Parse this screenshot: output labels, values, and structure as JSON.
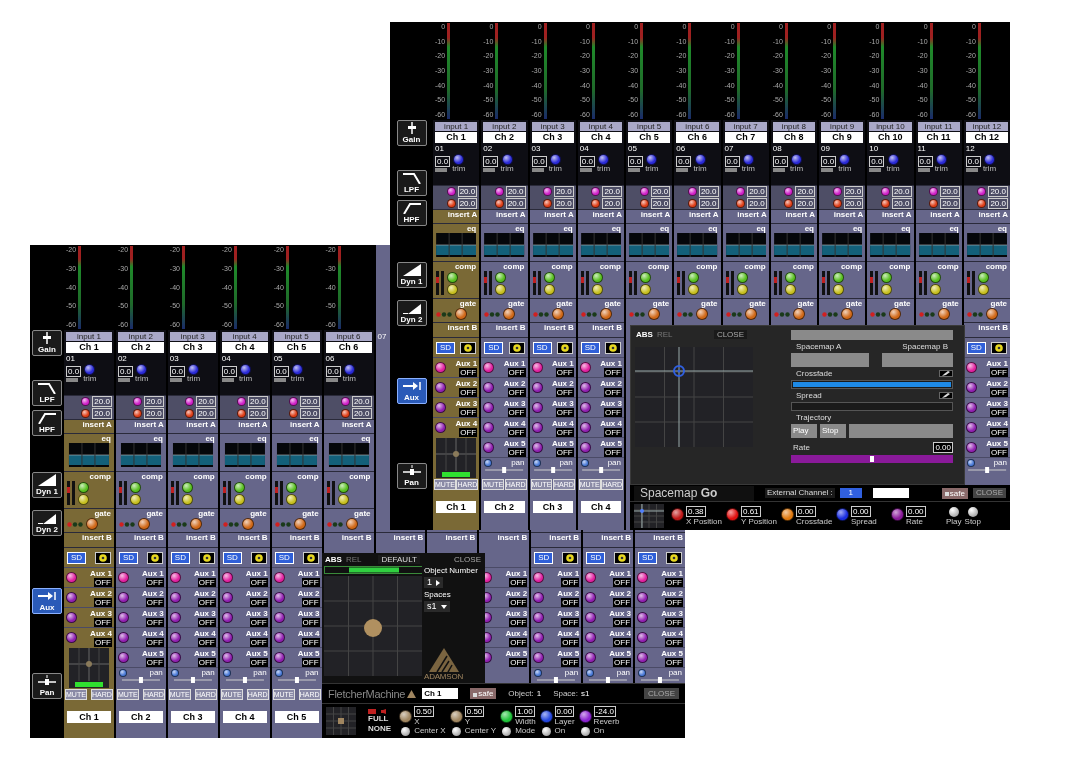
{
  "windows": [
    {
      "sidebar": [
        {
          "kind": "gain",
          "label": "Gain",
          "selected": false
        },
        {
          "kind": "lpf",
          "label": "LPF",
          "selected": false
        },
        {
          "kind": "hpf",
          "label": "HPF",
          "selected": false
        },
        {
          "kind": "dyn1",
          "label": "Dyn 1",
          "selected": false
        },
        {
          "kind": "dyn2",
          "label": "Dyn 2",
          "selected": false
        },
        {
          "kind": "aux",
          "label": "Aux",
          "selected": true
        },
        {
          "kind": "pan",
          "label": "Pan",
          "selected": false
        }
      ],
      "strips": [
        {
          "selected": true,
          "meter_scale": [
            "-20",
            "-30",
            "-40",
            "-50",
            "-60"
          ],
          "input": "input 1",
          "name": "Ch 1",
          "num": "01",
          "gain": "0.0",
          "trim": "trim",
          "lpf": "20.0",
          "hpf": "20.0",
          "insert_a": "insert A",
          "eq": "eq",
          "comp": "comp",
          "gate": "gate",
          "insert_b": "insert B",
          "sd": "SD",
          "sends": [
            {
              "label": "Aux 1",
              "state": "OFF"
            },
            {
              "label": "Aux 2",
              "state": "OFF"
            },
            {
              "label": "Aux 3",
              "state": "OFF"
            },
            {
              "label": "Aux 4",
              "state": "OFF"
            }
          ],
          "pad": true,
          "mute": "MUTE",
          "hard": "HARD",
          "name_bottom": "Ch 1"
        },
        {
          "selected": false,
          "meter_scale": [
            "-20",
            "-30",
            "-40",
            "-50",
            "-60"
          ],
          "input": "input 2",
          "name": "Ch 2",
          "num": "02",
          "gain": "0.0",
          "trim": "trim",
          "lpf": "20.0",
          "hpf": "20.0",
          "insert_a": "insert A",
          "eq": "eq",
          "comp": "comp",
          "gate": "gate",
          "insert_b": "insert B",
          "sd": "SD",
          "sends": [
            {
              "label": "Aux 1",
              "state": "OFF"
            },
            {
              "label": "Aux 2",
              "state": "OFF"
            },
            {
              "label": "Aux 3",
              "state": "OFF"
            },
            {
              "label": "Aux 4",
              "state": "OFF"
            },
            {
              "label": "Aux 5",
              "state": "OFF"
            }
          ],
          "pan": "pan",
          "mute": "MUTE",
          "hard": "HARD",
          "name_bottom": "Ch 2"
        },
        {
          "selected": false,
          "meter_scale": [
            "-20",
            "-30",
            "-40",
            "-50",
            "-60"
          ],
          "input": "input 3",
          "name": "Ch 3",
          "num": "03",
          "gain": "0.0",
          "trim": "trim",
          "lpf": "20.0",
          "hpf": "20.0",
          "insert_a": "insert A",
          "eq": "eq",
          "comp": "comp",
          "gate": "gate",
          "insert_b": "insert B",
          "sd": "SD",
          "sends": [
            {
              "label": "Aux 1",
              "state": "OFF"
            },
            {
              "label": "Aux 2",
              "state": "OFF"
            },
            {
              "label": "Aux 3",
              "state": "OFF"
            },
            {
              "label": "Aux 4",
              "state": "OFF"
            },
            {
              "label": "Aux 5",
              "state": "OFF"
            }
          ],
          "pan": "pan",
          "mute": "MUTE",
          "hard": "HARD",
          "name_bottom": "Ch 3"
        },
        {
          "selected": false,
          "meter_scale": [
            "-20",
            "-30",
            "-40",
            "-50",
            "-60"
          ],
          "input": "input 4",
          "name": "Ch 4",
          "num": "04",
          "gain": "0.0",
          "trim": "trim",
          "lpf": "20.0",
          "hpf": "20.0",
          "insert_a": "insert A",
          "eq": "eq",
          "comp": "comp",
          "gate": "gate",
          "insert_b": "insert B",
          "sd": "SD",
          "sends": [
            {
              "label": "Aux 1",
              "state": "OFF"
            },
            {
              "label": "Aux 2",
              "state": "OFF"
            },
            {
              "label": "Aux 3",
              "state": "OFF"
            },
            {
              "label": "Aux 4",
              "state": "OFF"
            },
            {
              "label": "Aux 5",
              "state": "OFF"
            }
          ],
          "pan": "pan",
          "mute": "MUTE",
          "hard": "HARD",
          "name_bottom": "Ch 4"
        },
        {
          "selected": false,
          "meter_scale": [
            "-20",
            "-30",
            "-40",
            "-50",
            "-60"
          ],
          "input": "input 5",
          "name": "Ch 5",
          "num": "05",
          "gain": "0.0",
          "trim": "trim",
          "lpf": "20.0",
          "hpf": "20.0",
          "insert_a": "insert A",
          "eq": "eq",
          "comp": "comp",
          "gate": "gate",
          "insert_b": "insert B",
          "sd": "SD",
          "sends": [
            {
              "label": "Aux 1",
              "state": "OFF"
            },
            {
              "label": "Aux 2",
              "state": "OFF"
            },
            {
              "label": "Aux 3",
              "state": "OFF"
            },
            {
              "label": "Aux 4",
              "state": "OFF"
            },
            {
              "label": "Aux 5",
              "state": "OFF"
            }
          ],
          "pan": "pan",
          "mute": "MUTE",
          "hard": "HARD",
          "name_bottom": "Ch 5"
        },
        {
          "selected": false,
          "meter_scale": [
            "-20",
            "-30",
            "-40",
            "-50",
            "-60"
          ],
          "input": "input 6",
          "name": "Ch 6",
          "num": "06",
          "gain": "0.0",
          "trim": "trim",
          "lpf": "20.0",
          "hpf": "20.0",
          "insert_a": "insert A",
          "eq": "eq",
          "comp": "comp",
          "gate": "gate",
          "insert_b": "insert B"
        },
        {
          "selected": false,
          "num": "07",
          "insert_b": "insert B"
        },
        {
          "selected": false,
          "insert_b": "insert B"
        },
        {
          "selected": false,
          "insert_b": "insert B",
          "sends": [
            {
              "label": "Aux 1",
              "state": "OFF"
            },
            {
              "label": "Aux 2",
              "state": "OFF"
            },
            {
              "label": "Aux 3",
              "state": "OFF"
            },
            {
              "label": "Aux 4",
              "state": "OFF"
            },
            {
              "label": "Aux 5",
              "state": "OFF"
            }
          ]
        },
        {
          "selected": false,
          "insert_b": "insert B",
          "sd": "SD",
          "sends": [
            {
              "label": "Aux 1",
              "state": "OFF"
            },
            {
              "label": "Aux 2",
              "state": "OFF"
            },
            {
              "label": "Aux 3",
              "state": "OFF"
            },
            {
              "label": "Aux 4",
              "state": "OFF"
            },
            {
              "label": "Aux 5",
              "state": "OFF"
            }
          ],
          "pan": "pan"
        },
        {
          "selected": false,
          "insert_b": "insert B",
          "sd": "SD",
          "sends": [
            {
              "label": "Aux 1",
              "state": "OFF"
            },
            {
              "label": "Aux 2",
              "state": "OFF"
            },
            {
              "label": "Aux 3",
              "state": "OFF"
            },
            {
              "label": "Aux 4",
              "state": "OFF"
            },
            {
              "label": "Aux 5",
              "state": "OFF"
            }
          ],
          "pan": "pan"
        },
        {
          "selected": false,
          "insert_b": "insert B",
          "sd": "SD",
          "sends": [
            {
              "label": "Aux 1",
              "state": "OFF"
            },
            {
              "label": "Aux 2",
              "state": "OFF"
            },
            {
              "label": "Aux 3",
              "state": "OFF"
            },
            {
              "label": "Aux 4",
              "state": "OFF"
            },
            {
              "label": "Aux 5",
              "state": "OFF"
            }
          ],
          "pan": "pan"
        }
      ],
      "panel": {
        "kind": "fletcher",
        "tabs": [
          {
            "label": "ABS",
            "selected": true
          },
          {
            "label": "REL",
            "selected": false
          }
        ],
        "default_button": "DEFAULT",
        "close_button": "CLOSE",
        "object_number_label": "Object Number",
        "object_number": "1",
        "spaces_label": "Spaces",
        "space": "s1",
        "logo": "ADAMSON",
        "brand": "FletcherMachine",
        "channel": "Ch 1",
        "safe": "safe",
        "object_label": "Object:",
        "object_value": "1",
        "space_label": "Space:",
        "space_value": "s1",
        "close_bottom": "CLOSE",
        "modes": [
          "FULL",
          "NONE"
        ],
        "controls": [
          {
            "label": "X",
            "value": "0.50",
            "color": "#a08660",
            "button": "Center X"
          },
          {
            "label": "Y",
            "value": "0.50",
            "color": "#a08660",
            "button": "Center Y"
          },
          {
            "label": "Width",
            "value": "1.00",
            "color": "#1fc43a",
            "button": "Mode"
          },
          {
            "label": "Layer",
            "value": "0.00",
            "color": "#2346e0",
            "button": "On"
          },
          {
            "label": "Reverb",
            "value": "-24.0",
            "color": "#8a22d0",
            "button": "On"
          }
        ]
      }
    },
    {
      "sidebar": [
        {
          "kind": "gain",
          "label": "Gain",
          "selected": false
        },
        {
          "kind": "lpf",
          "label": "LPF",
          "selected": false
        },
        {
          "kind": "hpf",
          "label": "HPF",
          "selected": false
        },
        {
          "kind": "dyn1",
          "label": "Dyn 1",
          "selected": false
        },
        {
          "kind": "dyn2",
          "label": "Dyn 2",
          "selected": false
        },
        {
          "kind": "aux",
          "label": "Aux",
          "selected": true
        },
        {
          "kind": "pan",
          "label": "Pan",
          "selected": false
        }
      ],
      "strips": [
        {
          "selected": true,
          "meter_scale": [
            "0",
            "-10",
            "-20",
            "-30",
            "-40",
            "-50",
            "-60"
          ],
          "input": "input 1",
          "name": "Ch 1",
          "num": "01",
          "gain": "0.0",
          "trim": "trim",
          "lpf": "20.0",
          "hpf": "20.0",
          "insert_a": "insert A",
          "eq": "eq",
          "comp": "comp",
          "gate": "gate",
          "insert_b": "insert B",
          "sd": "SD",
          "sends": [
            {
              "label": "Aux 1",
              "state": "OFF"
            },
            {
              "label": "Aux 2",
              "state": "OFF"
            },
            {
              "label": "Aux 3",
              "state": "OFF"
            },
            {
              "label": "Aux 4",
              "state": "OFF"
            }
          ],
          "pad": true,
          "mute": "MUTE",
          "hard": "HARD",
          "name_bottom": "Ch 1"
        },
        {
          "selected": false,
          "meter_scale": [
            "0",
            "-10",
            "-20",
            "-30",
            "-40",
            "-50",
            "-60"
          ],
          "input": "input 2",
          "name": "Ch 2",
          "num": "02",
          "gain": "0.0",
          "trim": "trim",
          "lpf": "20.0",
          "hpf": "20.0",
          "insert_a": "insert A",
          "eq": "eq",
          "comp": "comp",
          "gate": "gate",
          "insert_b": "insert B",
          "sd": "SD",
          "sends": [
            {
              "label": "Aux 1",
              "state": "OFF"
            },
            {
              "label": "Aux 2",
              "state": "OFF"
            },
            {
              "label": "Aux 3",
              "state": "OFF"
            },
            {
              "label": "Aux 4",
              "state": "OFF"
            },
            {
              "label": "Aux 5",
              "state": "OFF"
            }
          ],
          "pan": "pan",
          "mute": "MUTE",
          "hard": "HARD",
          "name_bottom": "Ch 2"
        },
        {
          "selected": false,
          "meter_scale": [
            "0",
            "-10",
            "-20",
            "-30",
            "-40",
            "-50",
            "-60"
          ],
          "input": "input 3",
          "name": "Ch 3",
          "num": "03",
          "gain": "0.0",
          "trim": "trim",
          "lpf": "20.0",
          "hpf": "20.0",
          "insert_a": "insert A",
          "eq": "eq",
          "comp": "comp",
          "gate": "gate",
          "insert_b": "insert B",
          "sd": "SD",
          "sends": [
            {
              "label": "Aux 1",
              "state": "OFF"
            },
            {
              "label": "Aux 2",
              "state": "OFF"
            },
            {
              "label": "Aux 3",
              "state": "OFF"
            },
            {
              "label": "Aux 4",
              "state": "OFF"
            },
            {
              "label": "Aux 5",
              "state": "OFF"
            }
          ],
          "pan": "pan",
          "mute": "MUTE",
          "hard": "HARD",
          "name_bottom": "Ch 3"
        },
        {
          "selected": false,
          "meter_scale": [
            "0",
            "-10",
            "-20",
            "-30",
            "-40",
            "-50",
            "-60"
          ],
          "input": "input 4",
          "name": "Ch 4",
          "num": "04",
          "gain": "0.0",
          "trim": "trim",
          "lpf": "20.0",
          "hpf": "20.0",
          "insert_a": "insert A",
          "eq": "eq",
          "comp": "comp",
          "gate": "gate",
          "insert_b": "insert B",
          "sd": "SD",
          "sends": [
            {
              "label": "Aux 1",
              "state": "OFF"
            },
            {
              "label": "Aux 2",
              "state": "OFF"
            },
            {
              "label": "Aux 3",
              "state": "OFF"
            },
            {
              "label": "Aux 4",
              "state": "OFF"
            },
            {
              "label": "Aux 5",
              "state": "OFF"
            }
          ],
          "pan": "pan",
          "mute": "MUTE",
          "hard": "HARD",
          "name_bottom": "Ch 4"
        },
        {
          "selected": false,
          "meter_scale": [
            "0",
            "-10",
            "-20",
            "-30",
            "-40",
            "-50",
            "-60"
          ],
          "input": "input 5",
          "name": "Ch 5",
          "num": "05",
          "gain": "0.0",
          "trim": "trim",
          "lpf": "20.0",
          "hpf": "20.0",
          "insert_a": "insert A",
          "eq": "eq",
          "comp": "comp",
          "gate": "gate"
        },
        {
          "selected": false,
          "meter_scale": [
            "0",
            "-10",
            "-20",
            "-30",
            "-40",
            "-50",
            "-60"
          ],
          "input": "input 6",
          "name": "Ch 6",
          "num": "06",
          "gain": "0.0",
          "trim": "trim",
          "lpf": "20.0",
          "hpf": "20.0",
          "insert_a": "insert A",
          "eq": "eq",
          "comp": "comp",
          "gate": "gate"
        },
        {
          "selected": false,
          "meter_scale": [
            "0",
            "-10",
            "-20",
            "-30",
            "-40",
            "-50",
            "-60"
          ],
          "input": "input 7",
          "name": "Ch 7",
          "num": "07",
          "gain": "0.0",
          "trim": "trim",
          "lpf": "20.0",
          "hpf": "20.0",
          "insert_a": "insert A",
          "eq": "eq",
          "comp": "comp",
          "gate": "gate"
        },
        {
          "selected": false,
          "meter_scale": [
            "0",
            "-10",
            "-20",
            "-30",
            "-40",
            "-50",
            "-60"
          ],
          "input": "input 8",
          "name": "Ch 8",
          "num": "08",
          "gain": "0.0",
          "trim": "trim",
          "lpf": "20.0",
          "hpf": "20.0",
          "insert_a": "insert A",
          "eq": "eq",
          "comp": "comp",
          "gate": "gate"
        },
        {
          "selected": false,
          "meter_scale": [
            "0",
            "-10",
            "-20",
            "-30",
            "-40",
            "-50",
            "-60"
          ],
          "input": "input 9",
          "name": "Ch 9",
          "num": "09",
          "gain": "0.0",
          "trim": "trim",
          "lpf": "20.0",
          "hpf": "20.0",
          "insert_a": "insert A",
          "eq": "eq",
          "comp": "comp",
          "gate": "gate"
        },
        {
          "selected": false,
          "meter_scale": [
            "0",
            "-10",
            "-20",
            "-30",
            "-40",
            "-50",
            "-60"
          ],
          "input": "input 10",
          "name": "Ch 10",
          "num": "10",
          "gain": "0.0",
          "trim": "trim",
          "lpf": "20.0",
          "hpf": "20.0",
          "insert_a": "insert A",
          "eq": "eq",
          "comp": "comp",
          "gate": "gate"
        },
        {
          "selected": false,
          "meter_scale": [
            "0",
            "-10",
            "-20",
            "-30",
            "-40",
            "-50",
            "-60"
          ],
          "input": "input 11",
          "name": "Ch 11",
          "num": "11",
          "gain": "0.0",
          "trim": "trim",
          "lpf": "20.0",
          "hpf": "20.0",
          "insert_a": "insert A",
          "eq": "eq",
          "comp": "comp",
          "gate": "gate"
        },
        {
          "selected": false,
          "meter_scale": [
            "0",
            "-10",
            "-20",
            "-30",
            "-40",
            "-50",
            "-60"
          ],
          "input": "input 12",
          "name": "Ch 12",
          "num": "12",
          "gain": "0.0",
          "trim": "trim",
          "lpf": "20.0",
          "hpf": "20.0",
          "insert_a": "insert A",
          "eq": "eq",
          "comp": "comp",
          "gate": "gate",
          "insert_b": "insert B",
          "sd": "SD",
          "sends": [
            {
              "label": "Aux 1",
              "state": "OFF"
            },
            {
              "label": "Aux 2",
              "state": "OFF"
            },
            {
              "label": "Aux 3",
              "state": "OFF"
            },
            {
              "label": "Aux 4",
              "state": "OFF"
            },
            {
              "label": "Aux 5",
              "state": "OFF"
            }
          ],
          "pan": "pan"
        }
      ],
      "panel": {
        "kind": "spacemap",
        "tabs": [
          {
            "label": "ABS",
            "selected": true
          },
          {
            "label": "REL",
            "selected": false
          }
        ],
        "close_button": "CLOSE",
        "labels": [
          "Spacemap A",
          "Spacemap B"
        ],
        "crossfade_label": "Crossfade",
        "crossfade": {
          "level": 1
        },
        "spread_label": "Spread",
        "spread": {
          "level": 0
        },
        "trajectory_label": "Trajectory",
        "play": "Play",
        "stop": "Stop",
        "rate_label": "Rate",
        "rate_value": "0.00",
        "rate": {
          "level": 0.5
        },
        "title": "Spacemap **Go**",
        "external_label": "External Channel :",
        "external_value": "1",
        "safe": "safe",
        "close_bottom": "CLOSE",
        "controls": [
          {
            "label": "X Position",
            "value": "0.38",
            "color": "#c01818"
          },
          {
            "label": "Y Position",
            "value": "0.61",
            "color": "#e01010"
          },
          {
            "label": "Crossfade",
            "value": "0.00",
            "color": "#e07a10"
          },
          {
            "label": "Spread",
            "value": "0.00",
            "color": "#1a2ee0"
          },
          {
            "label": "Rate",
            "value": "0.00",
            "color": "#8a1a9a"
          }
        ],
        "transport": [
          "Play",
          "Stop"
        ]
      }
    }
  ]
}
